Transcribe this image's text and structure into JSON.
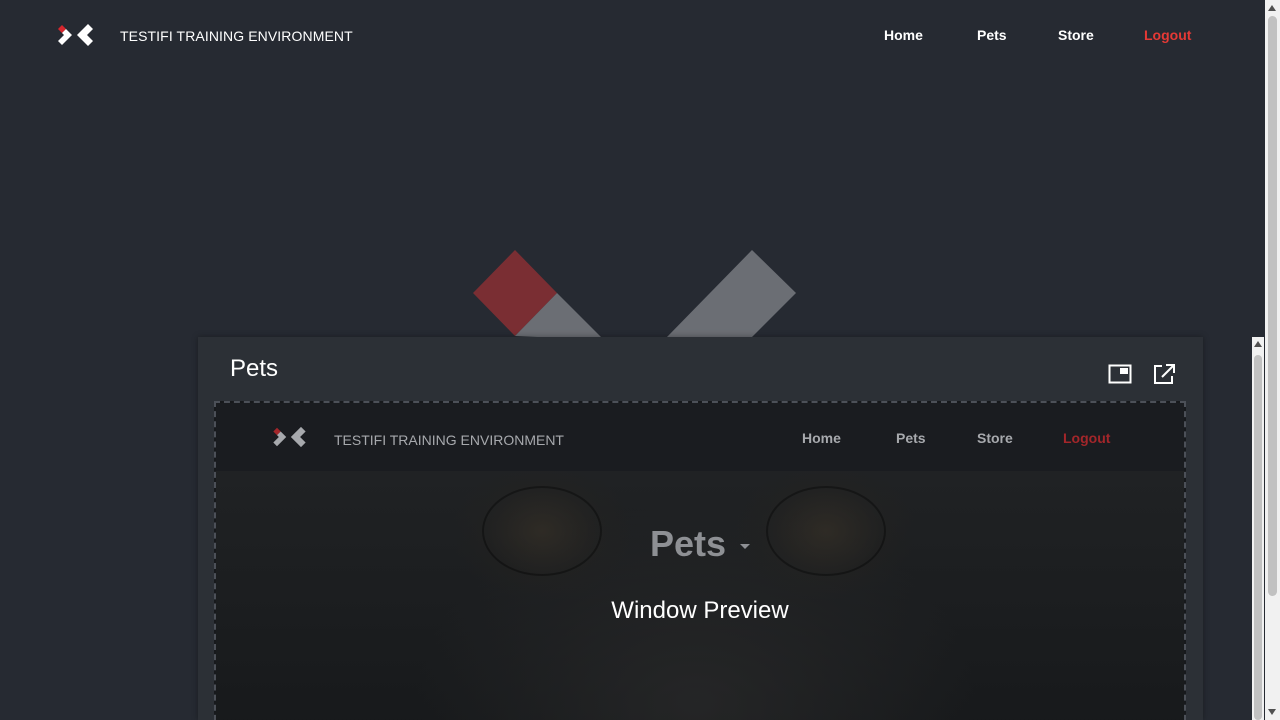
{
  "app": {
    "brand": "TESTIFI TRAINING ENVIRONMENT",
    "nav": {
      "home": "Home",
      "pets": "Pets",
      "store": "Store",
      "logout": "Logout"
    },
    "colors": {
      "background": "#262a32",
      "accent": "#e53935",
      "logo_red": "#d7262d"
    }
  },
  "panel": {
    "title": "Pets",
    "icons": [
      "picture-in-picture-icon",
      "open-external-icon"
    ]
  },
  "preview": {
    "brand": "TESTIFI TRAINING ENVIRONMENT",
    "nav": {
      "home": "Home",
      "pets": "Pets",
      "store": "Store",
      "logout": "Logout"
    },
    "hero_title": "Pets",
    "hero_subtitle": "Window Preview"
  }
}
